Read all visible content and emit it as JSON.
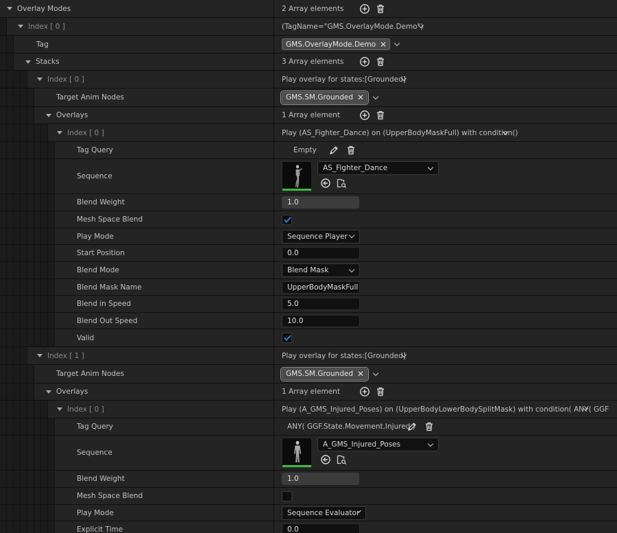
{
  "overlay_modes": {
    "label": "Overlay Modes",
    "value": "2 Array elements"
  },
  "mode0": {
    "index_label": "Index [ 0 ]",
    "summary": "(TagName=\"GMS.OverlayMode.Demo\")",
    "tag_label": "Tag",
    "tag_value": "GMS.OverlayMode.Demo",
    "stacks_label": "Stacks",
    "stacks_value": "3 Array elements"
  },
  "stack0": {
    "index_label": "Index [ 0 ]",
    "summary": "Play overlay for states:[Grounded]",
    "target_label": "Target Anim Nodes",
    "target_value": "GMS.SM.Grounded",
    "overlays_label": "Overlays",
    "overlays_value": "1 Array element",
    "overlay0": {
      "index_label": "Index [ 0 ]",
      "summary": "Play (AS_Fighter_Dance) on (UpperBodyMaskFull) with condition()",
      "tag_query_label": "Tag Query",
      "tag_query_value": "Empty",
      "sequence_label": "Sequence",
      "sequence_value": "AS_Fighter_Dance",
      "blend_weight_label": "Blend Weight",
      "blend_weight_value": "1.0",
      "mesh_space_label": "Mesh Space Blend",
      "mesh_space_checked": true,
      "play_mode_label": "Play Mode",
      "play_mode_value": "Sequence Player",
      "start_position_label": "Start Position",
      "start_position_value": "0.0",
      "blend_mode_label": "Blend Mode",
      "blend_mode_value": "Blend Mask",
      "mask_name_label": "Blend Mask Name",
      "mask_name_value": "UpperBodyMaskFull",
      "blend_in_label": "Blend in Speed",
      "blend_in_value": "5.0",
      "blend_out_label": "Blend Out Speed",
      "blend_out_value": "10.0",
      "valid_label": "Valid",
      "valid_checked": true
    }
  },
  "stack1": {
    "index_label": "Index [ 1 ]",
    "summary": "Play overlay for states:[Grounded]",
    "target_label": "Target Anim Nodes",
    "target_value": "GMS.SM.Grounded",
    "overlays_label": "Overlays",
    "overlays_value": "1 Array element",
    "overlay0": {
      "index_label": "Index [ 0 ]",
      "summary": "Play (A_GMS_Injured_Poses) on (UpperBodyLowerBodySplitMask) with condition( ANY( GGF",
      "tag_query_label": "Tag Query",
      "tag_query_value": "ANY( GGF.State.Movement.Injured )",
      "sequence_label": "Sequence",
      "sequence_value": "A_GMS_Injured_Poses",
      "blend_weight_label": "Blend Weight",
      "blend_weight_value": "1.0",
      "mesh_space_label": "Mesh Space Blend",
      "mesh_space_checked": false,
      "play_mode_label": "Play Mode",
      "play_mode_value": "Sequence Evaluator",
      "explicit_time_label": "Explicit Time",
      "explicit_time_value": "0.0"
    }
  },
  "colors": {
    "panel": "#242424",
    "guide": "#1b1b1b",
    "check": "#2f7fe0",
    "thumb_bar": "#3cbc3c"
  },
  "icons": [
    "add-icon",
    "trash-icon",
    "chevron-down-icon",
    "close-icon",
    "edit-icon",
    "browse-back-icon",
    "find-in-browser-icon",
    "checkmark-icon",
    "expand-arrow-icon"
  ]
}
